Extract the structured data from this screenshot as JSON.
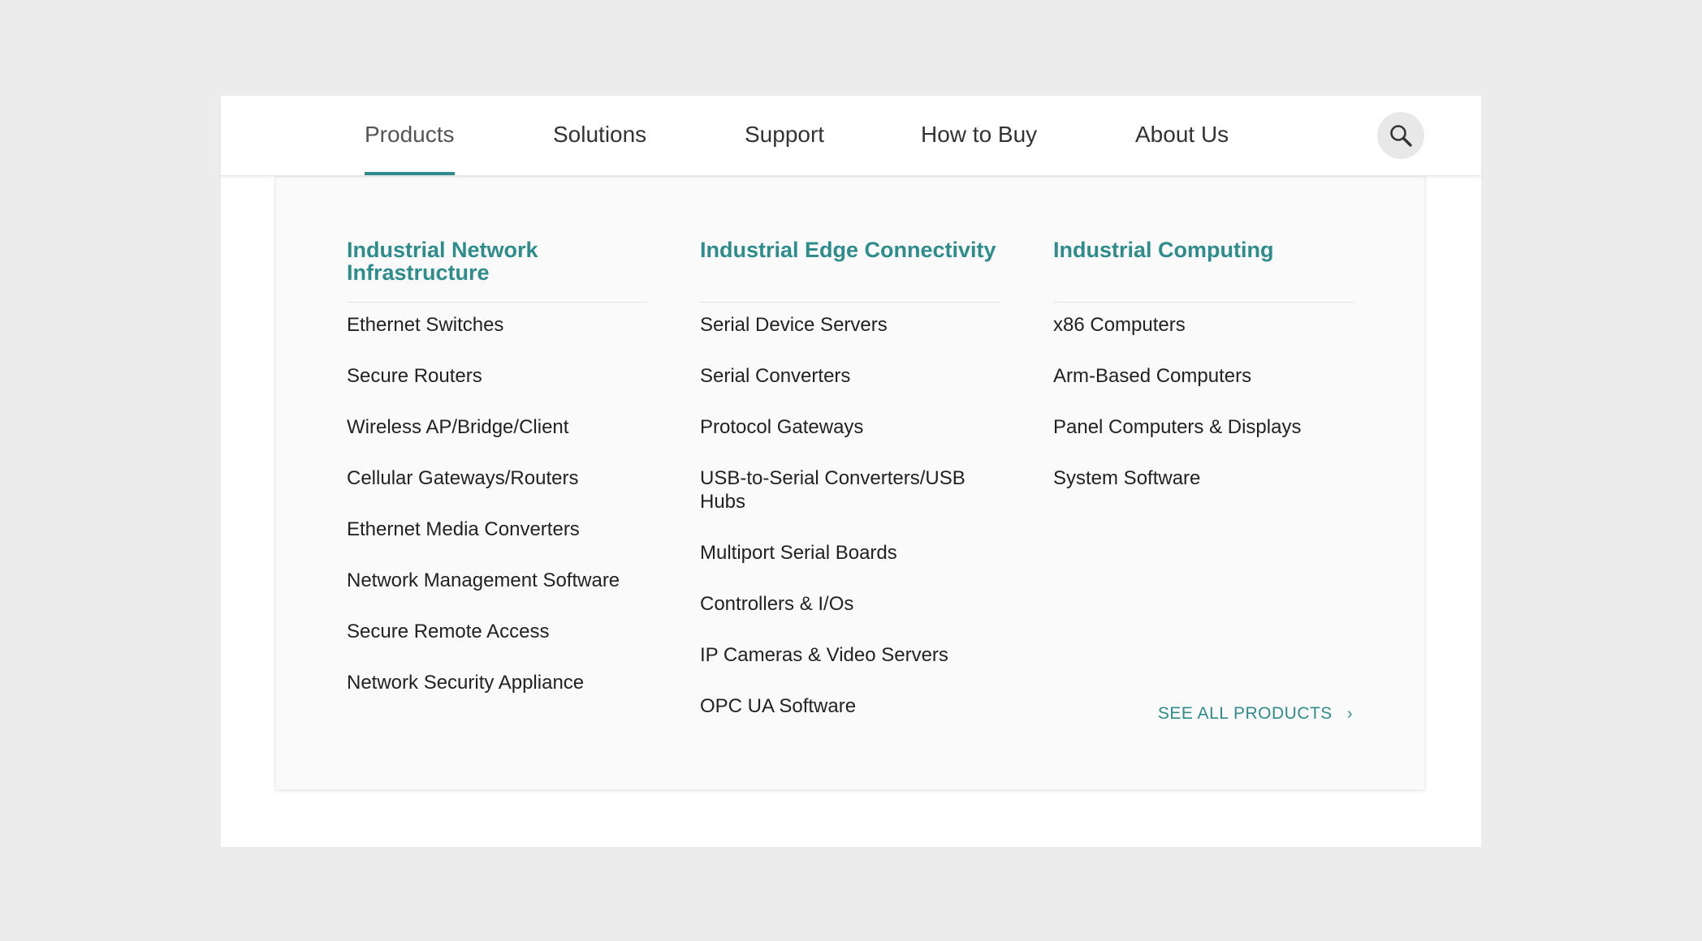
{
  "nav": {
    "items": [
      {
        "label": "Products",
        "active": true
      },
      {
        "label": "Solutions",
        "active": false
      },
      {
        "label": "Support",
        "active": false
      },
      {
        "label": "How to Buy",
        "active": false
      },
      {
        "label": "About Us",
        "active": false
      }
    ],
    "search_icon": "search-icon"
  },
  "menu": {
    "columns": [
      {
        "title": "Industrial Network Infrastructure",
        "items": [
          "Ethernet Switches",
          "Secure Routers",
          "Wireless AP/Bridge/Client",
          "Cellular Gateways/Routers",
          "Ethernet Media Converters",
          "Network Management Software",
          "Secure Remote Access",
          "Network Security Appliance"
        ]
      },
      {
        "title": "Industrial Edge Connectivity",
        "items": [
          "Serial Device Servers",
          "Serial Converters",
          "Protocol Gateways",
          "USB-to-Serial Converters/USB Hubs",
          "Multiport Serial Boards",
          "Controllers & I/Os",
          "IP Cameras & Video Servers",
          "OPC UA Software"
        ]
      },
      {
        "title": "Industrial Computing",
        "items": [
          "x86 Computers",
          "Arm-Based Computers",
          "Panel Computers & Displays",
          "System Software"
        ]
      }
    ],
    "see_all_label": "SEE ALL PRODUCTS",
    "see_all_icon": "chevron-right-icon"
  },
  "colors": {
    "accent": "#2f8c8c",
    "page_background": "#ececec",
    "dropdown_background": "#fafafa"
  }
}
